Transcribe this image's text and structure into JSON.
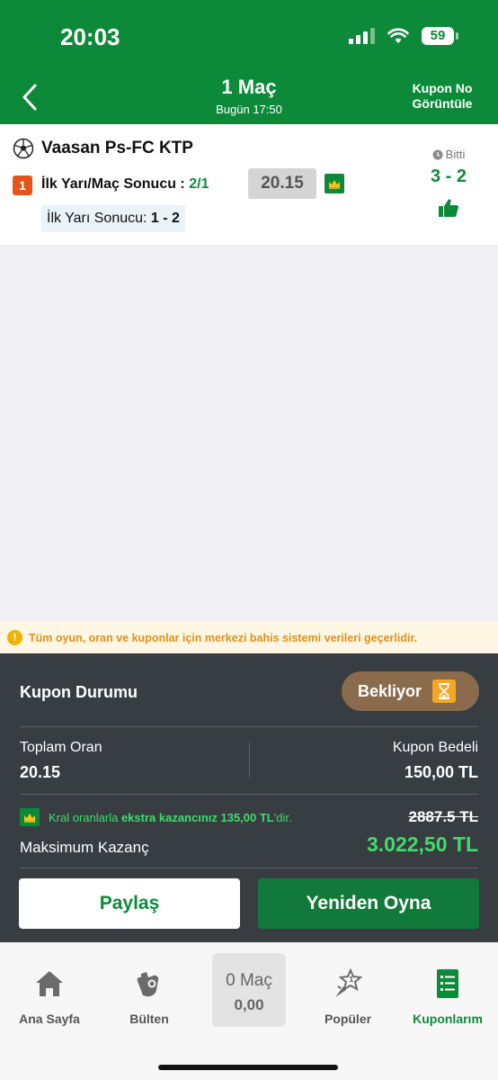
{
  "status_bar": {
    "time": "20:03",
    "battery": "59"
  },
  "header": {
    "title": "1 Maç",
    "subtitle": "Bugün 17:50",
    "right_action": "Kupon No Görüntüle"
  },
  "match": {
    "name": "Vaasan Ps-FC KTP",
    "selection_index": "1",
    "bet_type": "İlk Yarı/Maç Sonucu :",
    "pick": "2/1",
    "odds": "20.15",
    "half_time_label": "İlk Yarı Sonucu:",
    "half_time_score": "1 - 2",
    "status": "Bitti",
    "score": "3 - 2"
  },
  "notice": "Tüm oyun, oran ve kuponlar için merkezi bahis sistemi verileri geçerlidir.",
  "coupon": {
    "status_label": "Kupon Durumu",
    "status_value": "Bekliyor",
    "total_odds_label": "Toplam Oran",
    "total_odds": "20.15",
    "stake_label": "Kupon Bedeli",
    "stake": "150,00 TL",
    "king_text": {
      "before": "Kral oranlarla ",
      "bold": "ekstra kazancınız 135,00 TL",
      "after": "'dir."
    },
    "old_max": "2887.5 TL",
    "max_label": "Maksimum Kazanç",
    "max_value": "3.022,50 TL",
    "share_label": "Paylaş",
    "replay_label": "Yeniden Oyna"
  },
  "tabs": {
    "home": "Ana Sayfa",
    "bulletin": "Bülten",
    "basket_count": "0 Maç",
    "basket_amount": "0,00",
    "popular": "Popüler",
    "coupons": "Kuponlarım"
  },
  "colors": {
    "brand_green": "#0c8a3a",
    "panel": "#383d42",
    "accent_green": "#3fdc6a",
    "warning": "#e3901b"
  }
}
